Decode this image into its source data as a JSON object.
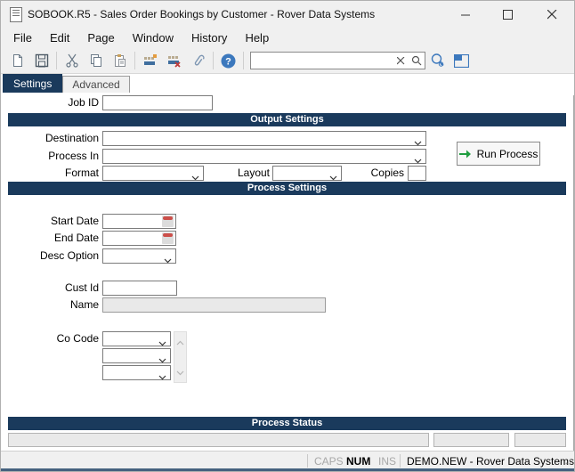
{
  "window": {
    "title": "SOBOOK.R5 - Sales Order Bookings by Customer - Rover Data Systems"
  },
  "menu": {
    "items": [
      "File",
      "Edit",
      "Page",
      "Window",
      "History",
      "Help"
    ]
  },
  "toolbar": {
    "search": {
      "value": "",
      "placeholder": ""
    },
    "icons": [
      "new-document",
      "save",
      "cut",
      "copy",
      "paste",
      "add-record",
      "delete-record",
      "attachment",
      "help",
      "search-clear",
      "search-magnifier",
      "find-view",
      "window-panel"
    ]
  },
  "tabs": {
    "settings": "Settings",
    "advanced": "Advanced"
  },
  "form": {
    "job_id": {
      "label": "Job ID",
      "value": ""
    },
    "output_section": {
      "title": "Output Settings",
      "destination_label": "Destination",
      "destination_value": "",
      "process_in_label": "Process In",
      "process_in_value": "",
      "format_label": "Format",
      "format_value": "",
      "layout_label": "Layout",
      "layout_value": "",
      "copies_label": "Copies",
      "copies_value": "",
      "run_button_label": "Run Process"
    },
    "process_section": {
      "title": "Process Settings",
      "start_date_label": "Start Date",
      "start_date_value": "",
      "end_date_label": "End Date",
      "end_date_value": "",
      "desc_option_label": "Desc Option",
      "desc_option_value": "",
      "cust_id_label": "Cust Id",
      "cust_id_value": "",
      "name_label": "Name",
      "name_value": "",
      "co_code_label": "Co Code",
      "co_code_values": [
        "",
        "",
        ""
      ]
    },
    "status_section": {
      "title": "Process Status",
      "fields": [
        "",
        "",
        ""
      ]
    }
  },
  "statusbar": {
    "caps": "CAPS",
    "num": "NUM",
    "ins": "INS",
    "connection": "DEMO.NEW - Rover Data Systems"
  },
  "colors": {
    "accent_navy": "#1a3a5c",
    "run_arrow_green": "#1f9d3f",
    "calendar_red": "#cc4f4a",
    "help_blue": "#3c78bd",
    "bottom_border_blue": "#46627f"
  }
}
